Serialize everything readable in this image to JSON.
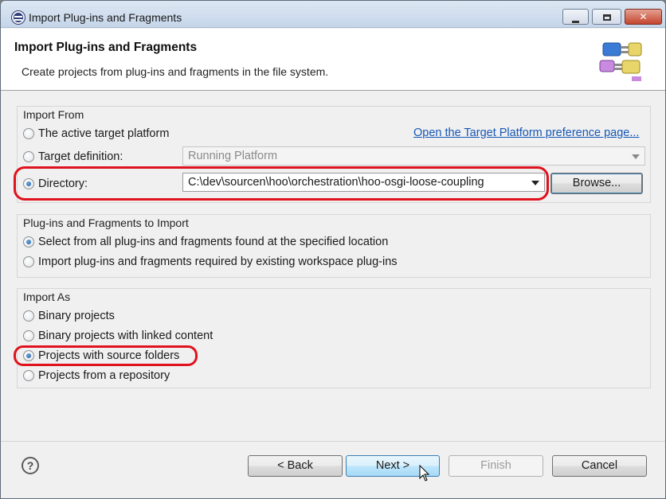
{
  "window": {
    "title": "Import Plug-ins and Fragments",
    "controls": {
      "minimize": "minimize-icon",
      "maximize": "maximize-icon",
      "close": "✕"
    }
  },
  "header": {
    "title": "Import Plug-ins and Fragments",
    "description": "Create projects from plug-ins and fragments in the file system.",
    "graphic": "plugin-connector-icon"
  },
  "import_from": {
    "group_label": "Import From",
    "active_target_label": "The active target platform",
    "target_definition_label": "Target definition:",
    "target_definition_value": "Running Platform",
    "directory_label": "Directory:",
    "directory_value": "C:\\dev\\sourcen\\hoo\\orchestration\\hoo-osgi-loose-coupling",
    "browse_label": "Browse...",
    "preference_link": "Open the Target Platform preference page...",
    "selected": "directory"
  },
  "plugins_to_import": {
    "group_label": "Plug-ins and Fragments to Import",
    "option_all": "Select from all plug-ins and fragments found at the specified location",
    "option_required": "Import plug-ins and fragments required by existing workspace plug-ins",
    "selected": "all"
  },
  "import_as": {
    "group_label": "Import As",
    "binary": "Binary projects",
    "binary_linked": "Binary projects with linked content",
    "source_folders": "Projects with source folders",
    "repository": "Projects from a repository",
    "selected": "source_folders"
  },
  "footer": {
    "help": "?",
    "back": "< Back",
    "next": "Next >",
    "finish": "Finish",
    "cancel": "Cancel"
  },
  "colors": {
    "highlight_ring": "#e0121d",
    "link": "#1557b7",
    "radio_fill": "#1e5aa6"
  }
}
